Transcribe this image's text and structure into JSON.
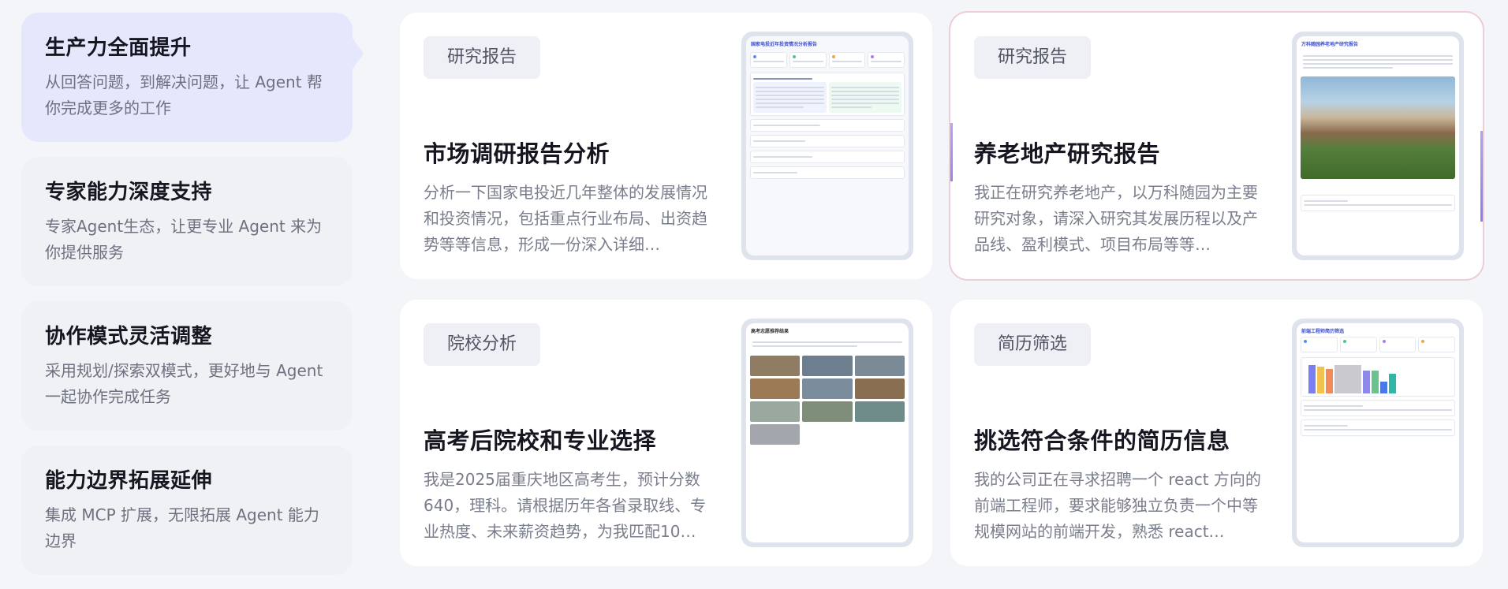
{
  "features": [
    {
      "title": "生产力全面提升",
      "desc": "从回答问题，到解决问题，让 Agent 帮你完成更多的工作",
      "active": true
    },
    {
      "title": "专家能力深度支持",
      "desc": "专家Agent生态，让更专业 Agent 来为你提供服务",
      "active": false
    },
    {
      "title": "协作模式灵活调整",
      "desc": "采用规划/探索双模式，更好地与 Agent 一起协作完成任务",
      "active": false
    },
    {
      "title": "能力边界拓展延伸",
      "desc": "集成 MCP 扩展，无限拓展 Agent 能力边界",
      "active": false
    }
  ],
  "cards": {
    "market": {
      "tag": "研究报告",
      "title": "市场调研报告分析",
      "desc": "分析一下国家电投近几年整体的发展情况和投资情况，包括重点行业布局、出资趋势等等信息，形成一份深入详细…",
      "preview_title": "国家电投近年投资情况分析报告"
    },
    "elderly": {
      "tag": "研究报告",
      "title": "养老地产研究报告",
      "desc": "我正在研究养老地产，以万科随园为主要研究对象，请深入研究其发展历程以及产品线、盈利模式、项目布局等等…",
      "preview_title": "万科随园养老地产研究报告"
    },
    "college": {
      "tag": "院校分析",
      "title": "高考后院校和专业选择",
      "desc": "我是2025届重庆地区高考生，预计分数640，理科。请根据历年各省录取线、专业热度、未来薪资趋势，为我匹配10…",
      "preview_title": "高考志愿推荐结果"
    },
    "resume": {
      "tag": "简历筛选",
      "title": "挑选符合条件的简历信息",
      "desc": "我的公司正在寻求招聘一个 react 方向的前端工程师，要求能够独立负责一个中等规模网站的前端开发，熟悉 react…",
      "preview_title": "前端工程师简历筛选"
    }
  },
  "colors": {
    "accent": "#3b4fd6",
    "active_feature_bg": "#e5e7fd",
    "highlight_border": "#e9aabe"
  }
}
